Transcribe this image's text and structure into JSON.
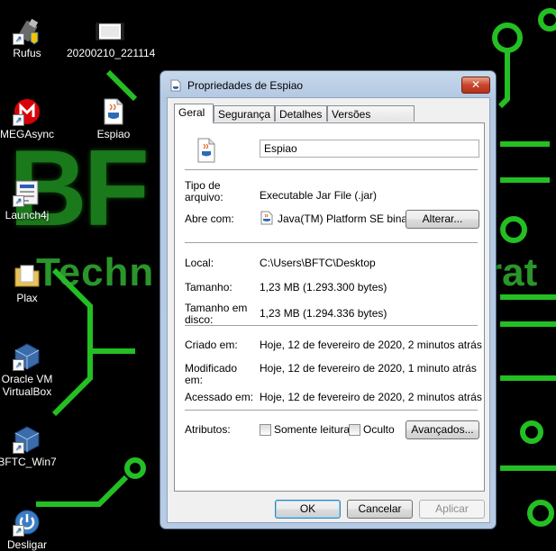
{
  "desktop": {
    "background_text_big": "BF",
    "background_text_row": "Techn",
    "background_text_row2": "rat",
    "icons": [
      {
        "label": "Rufus"
      },
      {
        "label": "20200210_221114"
      },
      {
        "label": "MEGAsync"
      },
      {
        "label": "Espiao"
      },
      {
        "label": "Launch4j"
      },
      {
        "label": "Plax"
      },
      {
        "label": "Oracle VM VirtualBox"
      },
      {
        "label": "BFTC_Win7"
      },
      {
        "label": "Desligar"
      }
    ]
  },
  "dialog": {
    "title": "Propriedades de Espiao",
    "close_label": "✕",
    "tabs": [
      "Geral",
      "Segurança",
      "Detalhes",
      "Versões Anteriores"
    ],
    "active_tab": "Geral",
    "file_name": "Espiao",
    "fields": {
      "type_label": "Tipo de arquivo:",
      "type_value": "Executable Jar File (.jar)",
      "opens_label": "Abre com:",
      "opens_value": "Java(TM) Platform SE binary",
      "change_button": "Alterar...",
      "location_label": "Local:",
      "location_value": "C:\\Users\\BFTC\\Desktop",
      "size_label": "Tamanho:",
      "size_value": "1,23 MB (1.293.300 bytes)",
      "disk_size_label": "Tamanho em disco:",
      "disk_size_value": "1,23 MB (1.294.336 bytes)",
      "created_label": "Criado em:",
      "created_value": "Hoje, 12 de fevereiro de 2020, 2 minutos atrás",
      "modified_label": "Modificado em:",
      "modified_value": "Hoje, 12 de fevereiro de 2020, 1 minuto atrás",
      "accessed_label": "Acessado em:",
      "accessed_value": "Hoje, 12 de fevereiro de 2020, 2 minutos atrás",
      "attributes_label": "Atributos:",
      "readonly_label": "Somente leitura",
      "hidden_label": "Oculto",
      "advanced_button": "Avançados..."
    },
    "buttons": {
      "ok": "OK",
      "cancel": "Cancelar",
      "apply": "Aplicar"
    }
  },
  "colors": {
    "desktop_bg": "#000000",
    "circuit_green": "#28d028",
    "window_frame": "#b7cbe4",
    "close_red": "#c8452a"
  }
}
